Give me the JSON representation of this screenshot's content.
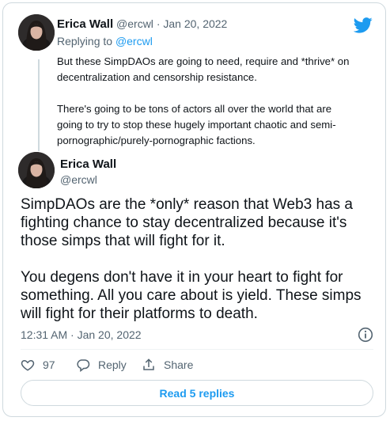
{
  "reply_tweet": {
    "author_name": "Erica Wall",
    "author_handle": "@ercwl",
    "separator": "·",
    "date": "Jan 20, 2022",
    "replying_to_label": "Replying to",
    "replying_to_handle": "@ercwl",
    "text_lines": [
      "But these SimpDAOs are going to need, require and *thrive* on",
      "decentralization and censorship resistance.",
      "",
      "There's going to be tons of actors all over the world that are",
      "going to try to stop these hugely important chaotic and semi-",
      "pornographic/purely-pornographic factions."
    ]
  },
  "main_tweet": {
    "author_name": "Erica Wall",
    "author_handle": "@ercwl",
    "text_lines": [
      "SimpDAOs are the *only* reason that Web3 has a",
      "fighting chance to stay decentralized because it's",
      "those simps that will fight for it.",
      "",
      "You degens don't have it in your heart to fight for",
      "something. All you care about is yield. These simps",
      "will fight for their platforms to death."
    ],
    "timestamp": "12:31 AM · Jan 20, 2022"
  },
  "actions": {
    "like_count": "97",
    "reply_label": "Reply",
    "share_label": "Share"
  },
  "read_replies_label": "Read 5 replies",
  "colors": {
    "accent": "#1d9bf0",
    "text": "#0f1419",
    "muted": "#536471",
    "border": "#cfd9de"
  },
  "icons": [
    "twitter-bird-icon",
    "info-icon",
    "heart-icon",
    "reply-icon",
    "share-icon"
  ]
}
